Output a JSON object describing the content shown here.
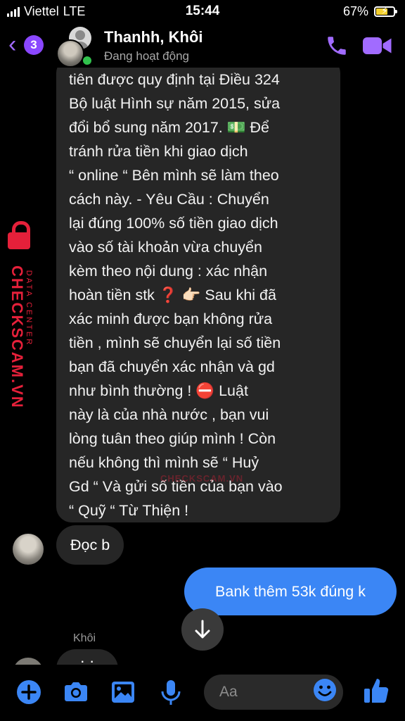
{
  "status_bar": {
    "carrier": "Viettel",
    "network": "LTE",
    "time": "15:44",
    "battery": "67%",
    "battery_fraction": 0.67
  },
  "header": {
    "unread_count": "3",
    "contact_name": "Thanhh, Khôi",
    "contact_status": "Đang hoạt động",
    "accent_color": "#a16bff"
  },
  "messages": {
    "long_incoming": "tiên được quy định tại Điều 324\nBộ luật Hình sự năm 2015, sửa\nđổi bổ sung năm 2017.   💵 Để\ntránh rửa tiền khi giao dịch\n“ online “ Bên mình sẽ làm theo\ncách này.  - Yêu Cầu : Chuyển\nlại đúng 100% số tiền giao dịch\nvào số tài khoản vừa chuyển\nkèm theo nội dung : xác nhận\nhoàn tiền stk ❓ 👉🏻 Sau khi đã\nxác minh được bạn không rửa\ntiền , mình sẽ chuyển lại số tiền\nbạn đã chuyển xác nhận và gd\nnhư bình thường !   ⛔ Luật\nnày là của nhà nước , bạn vui\nlòng tuân theo giúp mình ! Còn\nnếu không thì mình sẽ “ Huỷ\nGd “ Và gửi số tiền của bạn vào\n“ Quỹ “ Từ Thiện !",
    "short_incoming": "Đọc b",
    "outgoing": "Bank thêm 53k đúng k",
    "sender_label": "Khôi",
    "partial_incoming": "· ·",
    "outgoing_color": "#3b86f5"
  },
  "watermark": {
    "side_brand": "CHECKSCAM.VN",
    "side_sub": "DATA CENTER",
    "center_brand": "CHECKSCAM.VN"
  },
  "composer": {
    "placeholder": "Aa",
    "icons": [
      "plus-icon",
      "camera-icon",
      "image-icon",
      "microphone-icon",
      "emoji-icon",
      "thumbs-up-icon"
    ]
  }
}
